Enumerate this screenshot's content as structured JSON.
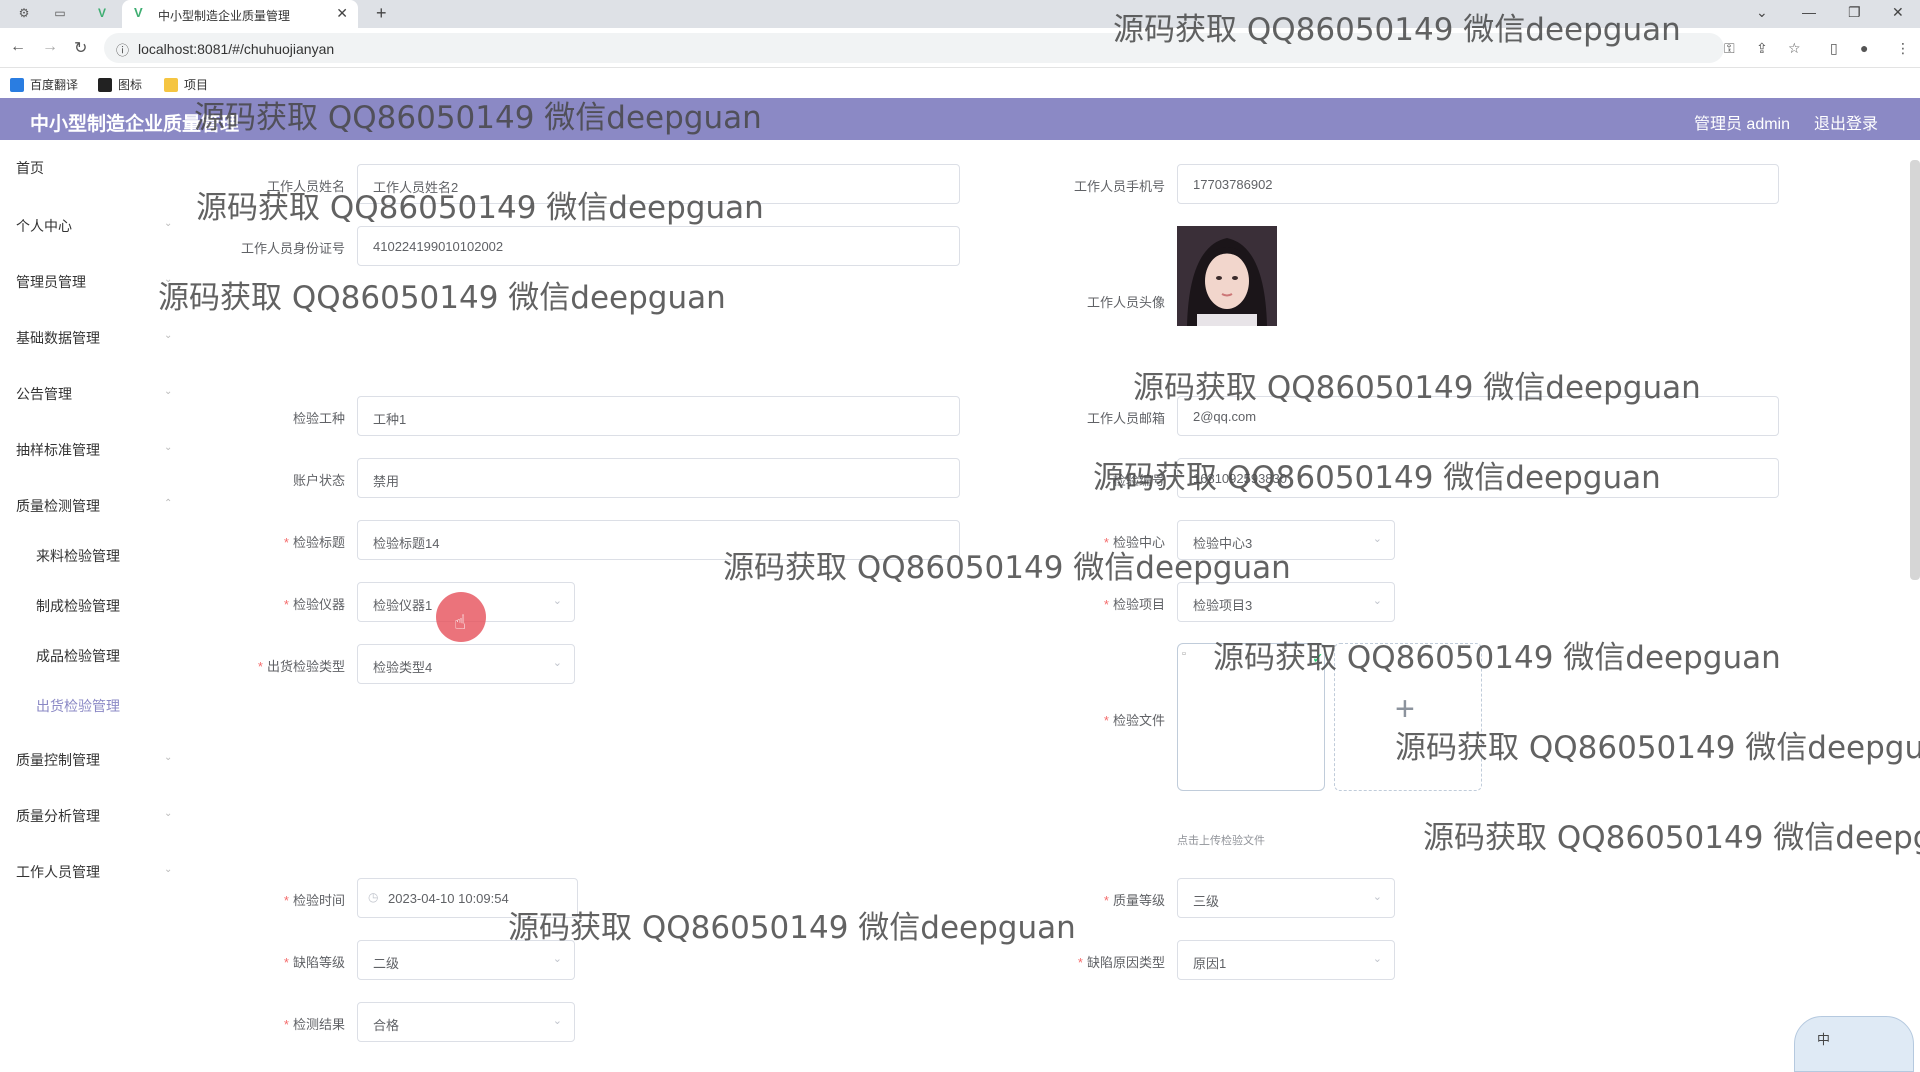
{
  "browser": {
    "tab_title": "中小型制造企业质量管理",
    "url": "localhost:8081/#/chuhuojianyan",
    "bookmarks": [
      "百度翻译",
      "图标",
      "项目"
    ]
  },
  "header": {
    "title": "中小型制造企业质量管理",
    "user": "管理员 admin",
    "logout": "退出登录"
  },
  "sidebar": {
    "items": [
      {
        "label": "首页"
      },
      {
        "label": "个人中心"
      },
      {
        "label": "管理员管理"
      },
      {
        "label": "基础数据管理"
      },
      {
        "label": "公告管理"
      },
      {
        "label": "抽样标准管理"
      },
      {
        "label": "质量检测管理"
      },
      {
        "label": "质量控制管理"
      },
      {
        "label": "质量分析管理"
      },
      {
        "label": "工作人员管理"
      }
    ],
    "subitems": [
      {
        "label": "来料检验管理"
      },
      {
        "label": "制成检验管理"
      },
      {
        "label": "成品检验管理"
      },
      {
        "label": "出货检验管理"
      }
    ]
  },
  "form": {
    "name_label": "工作人员姓名",
    "name_value": "工作人员姓名2",
    "phone_label": "工作人员手机号",
    "phone_value": "17703786902",
    "idcard_label": "工作人员身份证号",
    "idcard_value": "410224199010102002",
    "avatar_label": "工作人员头像",
    "worktype_label": "检验工种",
    "worktype_value": "工种1",
    "email_label": "工作人员邮箱",
    "email_value": "2@qq.com",
    "status_label": "账户状态",
    "status_value": "禁用",
    "number_label": "检验编号",
    "number_value": "1681092593830",
    "title_label": "检验标题",
    "title_value": "检验标题14",
    "center_label": "检验中心",
    "center_value": "检验中心3",
    "instrument_label": "检验仪器",
    "instrument_value": "检验仪器1",
    "item_label": "检验项目",
    "item_value": "检验项目3",
    "shiptype_label": "出货检验类型",
    "shiptype_value": "检验类型4",
    "file_label": "检验文件",
    "file_tip": "点击上传检验文件",
    "time_label": "检验时间",
    "time_value": "2023-04-10 10:09:54",
    "grade_label": "质量等级",
    "grade_value": "三级",
    "defect_label": "缺陷等级",
    "defect_value": "二级",
    "cause_label": "缺陷原因类型",
    "cause_value": "原因1",
    "result_label": "检测结果",
    "result_value": "合格"
  },
  "watermark": {
    "text": "源码获取 QQ86050149 微信deepguan",
    "clipped_1": "源码获取 QQ86050149 微信deepguar",
    "clipped_2": "源码获取 QQ86050149 微信deepgu"
  },
  "ime_widget": {
    "label": "中"
  },
  "colors": {
    "header": "#8b89c5",
    "required": "#f56c6c",
    "active_menu": "#8b89c5"
  }
}
